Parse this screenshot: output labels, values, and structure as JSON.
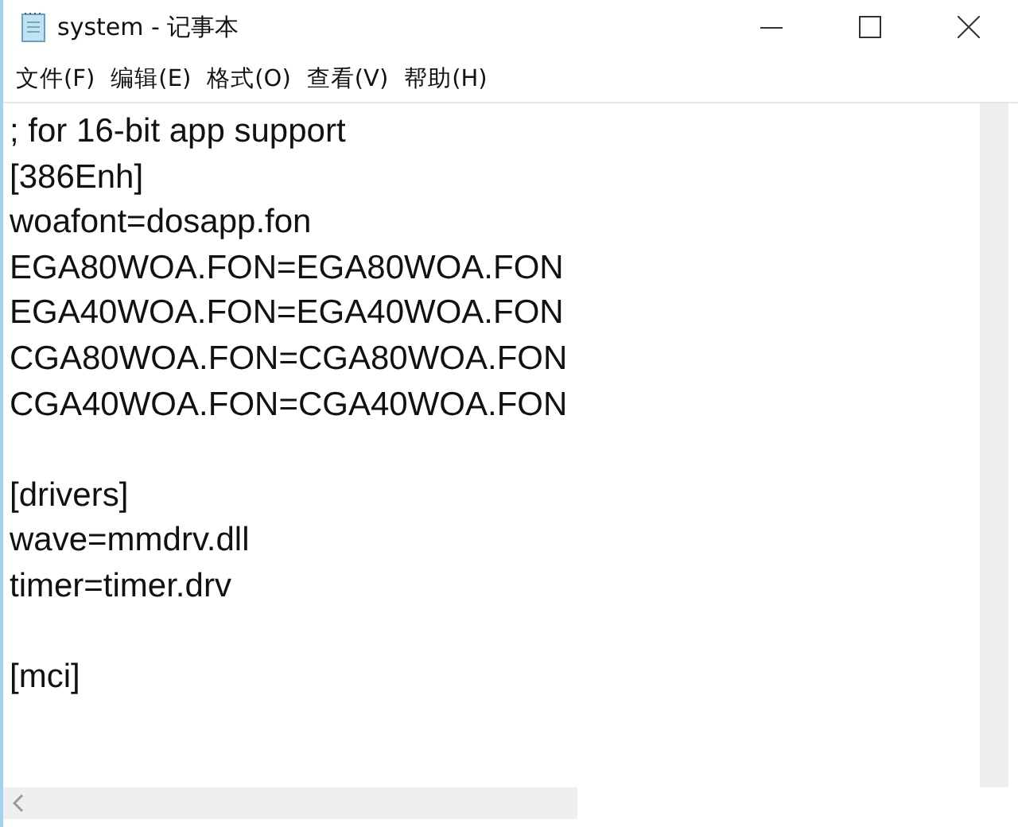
{
  "window": {
    "title": "system - 记事本"
  },
  "menu": [
    "文件(F)",
    "编辑(E)",
    "格式(O)",
    "查看(V)",
    "帮助(H)"
  ],
  "document": {
    "blocks": [
      [
        "; for 16-bit app support",
        "[386Enh]",
        "woafont=dosapp.fon",
        "EGA80WOA.FON=EGA80WOA.FON",
        "EGA40WOA.FON=EGA40WOA.FON",
        "CGA80WOA.FON=CGA80WOA.FON",
        "CGA40WOA.FON=CGA40WOA.FON"
      ],
      [
        "[drivers]",
        "wave=mmdrv.dll",
        "timer=timer.drv"
      ],
      [
        "[mci]"
      ]
    ]
  }
}
